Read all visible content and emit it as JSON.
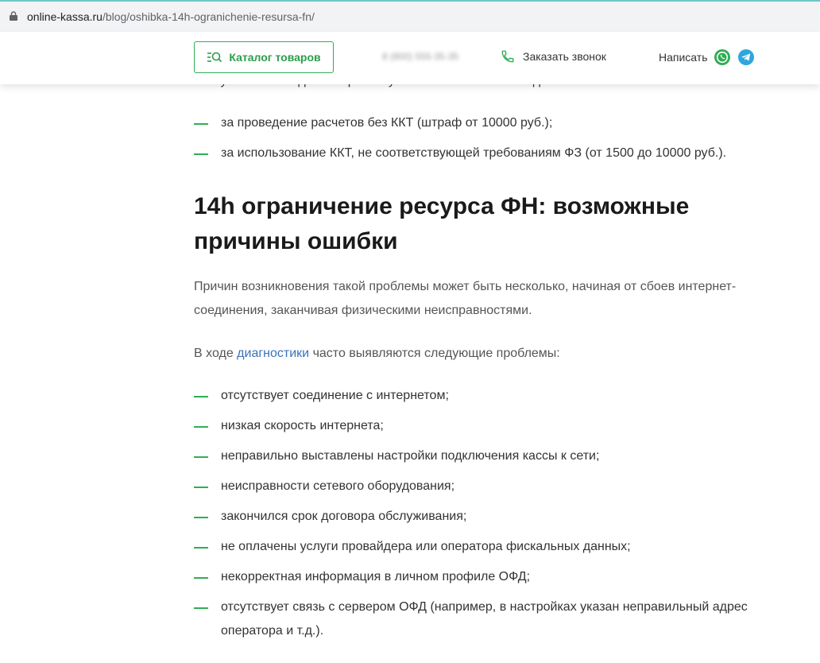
{
  "browser": {
    "url_domain": "online-kassa.ru",
    "url_path": "/blog/oshibka-14h-ogranichenie-resursa-fn/"
  },
  "header": {
    "catalog_label": "Каталог товаров",
    "phone": "8 (800) 555-35-35",
    "callback_label": "Заказать звонок",
    "write_label": "Написать",
    "accent": "#2fae55"
  },
  "article": {
    "cut_text": "влекут за собой административную ответственность по одной из статей:",
    "fines": [
      "за проведение расчетов без ККТ (штраф от 10000 руб.);",
      "за использование ККТ, не соответствующей требованиям ФЗ (от 1500 до 10000 руб.)."
    ],
    "heading": "14h ограничение ресурса ФН: возможные причины ошибки",
    "intro": "Причин возникновения такой проблемы может быть несколько, начиная от сбоев интернет-соединения, заканчивая физическими неисправностями.",
    "diag_prefix": "В ходе ",
    "diag_link": "диагностики",
    "diag_suffix": " часто выявляются следующие проблемы:",
    "problems": [
      "отсутствует соединение с интернетом;",
      "низкая скорость интернета;",
      "неправильно выставлены настройки подключения кассы к сети;",
      "неисправности сетевого оборудования;",
      "закончился срок договора обслуживания;",
      "не оплачены услуги провайдера или оператора фискальных данных;",
      "некорректная информация в личном профиле ОФД;",
      "отсутствует связь с сервером ОФД (например, в настройках указан неправильный адрес оператора и т.д.)."
    ]
  }
}
